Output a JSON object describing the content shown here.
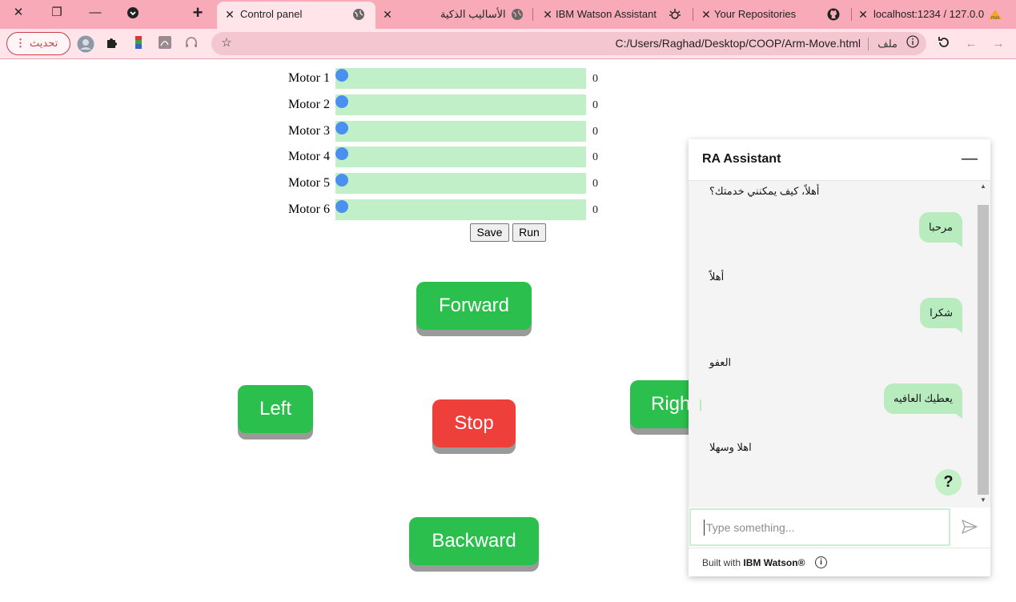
{
  "browser": {
    "tabs": [
      {
        "label": "Control panel",
        "active": true
      },
      {
        "label": "الأساليب الذكية",
        "active": false
      },
      {
        "label": "IBM Watson Assistant",
        "active": false
      },
      {
        "label": "Your Repositories",
        "active": false
      },
      {
        "label": "localhost:1234 / 127.0.0",
        "active": false
      }
    ],
    "new_tab": "+",
    "update_label": "تحديث",
    "address": {
      "scheme_label": "ملف",
      "url": "C:/Users/Raghad/Desktop/COOP/Arm-Move.html"
    }
  },
  "motors": [
    {
      "label": "Motor 1",
      "value": "0"
    },
    {
      "label": "Motor 2",
      "value": "0"
    },
    {
      "label": "Motor 3",
      "value": "0"
    },
    {
      "label": "Motor 4",
      "value": "0"
    },
    {
      "label": "Motor 5",
      "value": "0"
    },
    {
      "label": "Motor 6",
      "value": "0"
    }
  ],
  "actions": {
    "save": "Save",
    "run": "Run"
  },
  "direction": {
    "forward": "Forward",
    "left": "Left",
    "stop": "Stop",
    "right": "Righ",
    "backward": "Backward"
  },
  "chat": {
    "title": "RA Assistant",
    "minimize": "—",
    "messages": [
      {
        "from": "bot",
        "text": "أهلاً، كيف يمكنني خدمتك؟"
      },
      {
        "from": "user",
        "text": "مرحبا"
      },
      {
        "from": "bot",
        "text": "أهلاً"
      },
      {
        "from": "user",
        "text": "شكرا"
      },
      {
        "from": "bot",
        "text": "العفو"
      },
      {
        "from": "user",
        "text": "يعطيك العافيه"
      },
      {
        "from": "bot",
        "text": "اهلا وسهلا"
      }
    ],
    "help": "?",
    "input_placeholder": "Type something...",
    "footer_prefix": "Built with ",
    "footer_brand": "IBM Watson®",
    "info": "i"
  },
  "colors": {
    "tabstrip": "#f8aab8",
    "slider_track": "#c1efc7",
    "slider_thumb": "#4a90f0",
    "button_green": "#2bbf4d",
    "button_red": "#ef3f3a",
    "user_bubble": "#b8ecbe"
  }
}
